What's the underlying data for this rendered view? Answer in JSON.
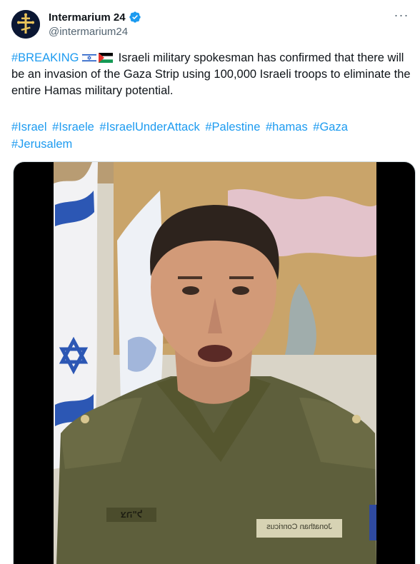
{
  "author": {
    "display_name": "Intermarium 24",
    "handle": "@intermarium24",
    "avatar_icon": "orthodox-cross-icon",
    "verified_icon": "verified-badge-icon"
  },
  "tweet": {
    "breaking_tag": "#BREAKING",
    "text": "Israeli military spokesman has confirmed that there will be an invasion of the Gaza Strip using 100,000 Israeli troops to eliminate the entire Hamas military potential.",
    "hashtags": [
      "#Israel",
      "#Israele",
      "#IsraelUnderAttack",
      "#Palestine",
      "#hamas",
      "#Gaza",
      "#Jerusalem"
    ]
  },
  "media": {
    "nametag": "Jonathan Conricus",
    "chest_tag": "צה\"ל"
  },
  "colors": {
    "link": "#1d9bf0",
    "text": "#0f1419",
    "secondary": "#536471"
  }
}
